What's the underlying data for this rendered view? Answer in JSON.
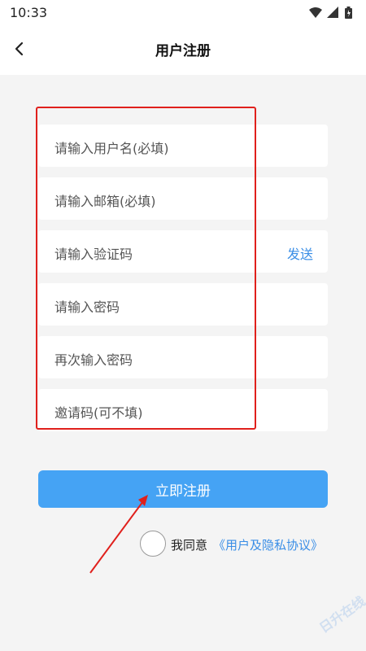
{
  "status_bar": {
    "time": "10:33"
  },
  "nav": {
    "title": "用户注册"
  },
  "form": {
    "username": {
      "placeholder": "请输入用户名(必填)"
    },
    "email": {
      "placeholder": "请输入邮箱(必填)"
    },
    "code": {
      "placeholder": "请输入验证码",
      "send_label": "发送"
    },
    "password": {
      "placeholder": "请输入密码"
    },
    "confirm_password": {
      "placeholder": "再次输入密码"
    },
    "invite": {
      "placeholder": "邀请码(可不填)"
    }
  },
  "register_button": {
    "label": "立即注册"
  },
  "agreement": {
    "text": "我同意",
    "link": "《用户及隐私协议》",
    "checked": false
  },
  "watermark": {
    "text": "日升在线"
  },
  "colors": {
    "accent": "#45a3f4",
    "link": "#3a8ee6",
    "highlight": "#e0201c",
    "background": "#f4f4f4"
  },
  "icons": [
    "wifi-icon",
    "signal-icon",
    "battery-icon",
    "back-arrow-icon"
  ]
}
